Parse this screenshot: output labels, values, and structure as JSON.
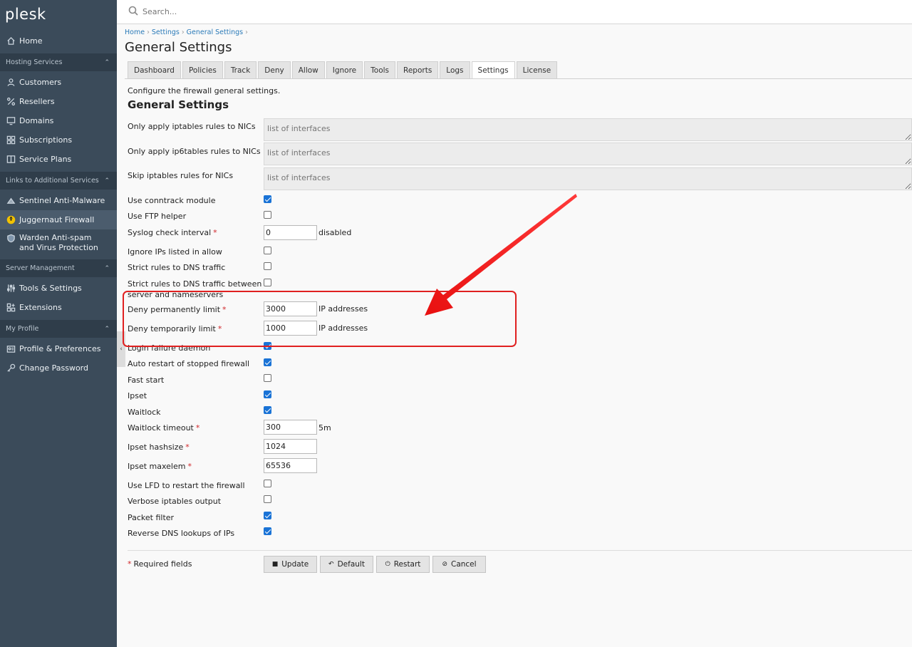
{
  "app": {
    "logo": "plesk"
  },
  "search": {
    "placeholder": "Search..."
  },
  "sidebar": {
    "home": "Home",
    "hosting_section": "Hosting Services",
    "hosting": [
      "Customers",
      "Resellers",
      "Domains",
      "Subscriptions",
      "Service Plans"
    ],
    "links_section": "Links to Additional Services",
    "links": [
      "Sentinel Anti-Malware",
      "Juggernaut Firewall",
      "Warden Anti-spam and Virus Protection"
    ],
    "server_section": "Server Management",
    "server": [
      "Tools & Settings",
      "Extensions"
    ],
    "profile_section": "My Profile",
    "profile": [
      "Profile & Preferences",
      "Change Password"
    ]
  },
  "breadcrumb": [
    "Home",
    "Settings",
    "General Settings"
  ],
  "page_title": "General Settings",
  "tabs": [
    "Dashboard",
    "Policies",
    "Track",
    "Deny",
    "Allow",
    "Ignore",
    "Tools",
    "Reports",
    "Logs",
    "Settings",
    "License"
  ],
  "active_tab": "Settings",
  "description": "Configure the firewall general settings.",
  "section_title": "General Settings",
  "nic_fields": [
    {
      "label": "Only apply iptables rules to NICs",
      "placeholder": "list of interfaces"
    },
    {
      "label": "Only apply ip6tables rules to NICs",
      "placeholder": "list of interfaces"
    },
    {
      "label": "Skip iptables rules for NICs",
      "placeholder": "list of interfaces"
    }
  ],
  "fields": {
    "conntrack": {
      "label": "Use conntrack module",
      "checked": true
    },
    "ftp_helper": {
      "label": "Use FTP helper",
      "checked": false
    },
    "syslog": {
      "label": "Syslog check interval",
      "value": "0",
      "unit": "disabled"
    },
    "ignore_ips": {
      "label": "Ignore IPs listed in allow",
      "checked": false
    },
    "strict_dns": {
      "label": "Strict rules to DNS traffic",
      "checked": false
    },
    "strict_dns_ns": {
      "label_1": "Strict rules to DNS traffic between",
      "label_2": "server and nameservers",
      "checked": false
    },
    "deny_perm": {
      "label": "Deny permanently limit",
      "value": "3000",
      "unit": "IP addresses"
    },
    "deny_temp": {
      "label": "Deny temporarily limit",
      "value": "1000",
      "unit": "IP addresses"
    },
    "login_failure": {
      "label": "Login failure daemon",
      "checked": true
    },
    "auto_restart": {
      "label": "Auto restart of stopped firewall",
      "checked": true
    },
    "fast_start": {
      "label": "Fast start",
      "checked": false
    },
    "ipset": {
      "label": "Ipset",
      "checked": true
    },
    "waitlock": {
      "label": "Waitlock",
      "checked": true
    },
    "waitlock_timeout": {
      "label": "Waitlock timeout",
      "value": "300",
      "unit": "5m"
    },
    "ipset_hashsize": {
      "label": "Ipset hashsize",
      "value": "1024"
    },
    "ipset_maxelem": {
      "label": "Ipset maxelem",
      "value": "65536"
    },
    "lfd_restart": {
      "label": "Use LFD to restart the firewall",
      "checked": false
    },
    "verbose": {
      "label": "Verbose iptables output",
      "checked": false
    },
    "packet_filter": {
      "label": "Packet filter",
      "checked": true
    },
    "reverse_dns": {
      "label": "Reverse DNS lookups of IPs",
      "checked": true
    }
  },
  "required_note": "Required fields",
  "required_marker": "*",
  "buttons": {
    "update": "Update",
    "default": "Default",
    "restart": "Restart",
    "cancel": "Cancel"
  },
  "colors": {
    "sidebar": "#3b4b5a",
    "accent": "#1a73d6",
    "annotation": "#e02020"
  }
}
